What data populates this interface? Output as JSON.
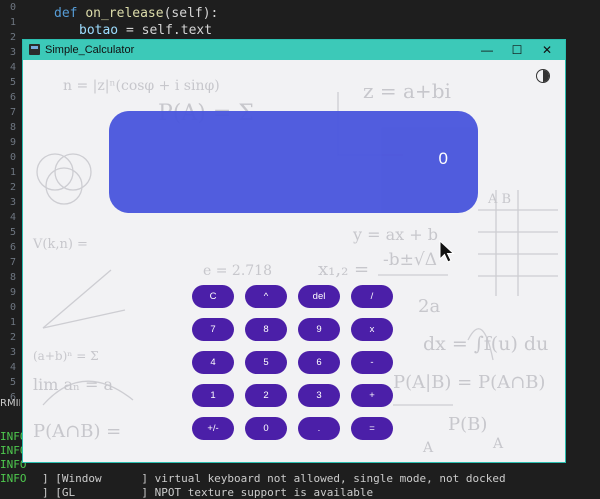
{
  "editor": {
    "line_numbers": [
      "0",
      "1",
      "2",
      "3",
      "4",
      "5",
      "6",
      "7",
      "8",
      "9",
      "0",
      "1",
      "2",
      "3",
      "4",
      "5",
      "6",
      "7",
      "8",
      "9",
      "0",
      "1",
      "2",
      "3",
      "4",
      "5",
      "6"
    ],
    "code": {
      "def_kw": "def",
      "fn_name": "on_release",
      "fn_args": "(self):",
      "assign_var": "botao",
      "assign_rest": " = self.text"
    },
    "panel_tab": "RMIN",
    "terminal": {
      "info_labels": [
        "INFO",
        "INFO",
        "INFO",
        "INFO"
      ],
      "lines": [
        "] [Window      ] virtual keyboard not allowed, single mode, not docked",
        "] [GL          ] NPOT texture support is available"
      ]
    }
  },
  "window": {
    "title": "Simple_Calculator",
    "minimize": "—",
    "maximize": "☐",
    "close": "✕"
  },
  "display": {
    "value": "0"
  },
  "keypad": {
    "rows": [
      [
        "C",
        "^",
        "del",
        "/"
      ],
      [
        "7",
        "8",
        "9",
        "x"
      ],
      [
        "4",
        "5",
        "6",
        "-"
      ],
      [
        "1",
        "2",
        "3",
        "+"
      ],
      [
        "+/-",
        "0",
        ".",
        "="
      ]
    ]
  },
  "colors": {
    "titlebar": "#3cc9b8",
    "display": "#4a56dd",
    "button": "#4b1fa8"
  },
  "icons": {
    "theme_toggle": "half-circle-icon",
    "mouse_cursor": "arrow-cursor-icon"
  }
}
